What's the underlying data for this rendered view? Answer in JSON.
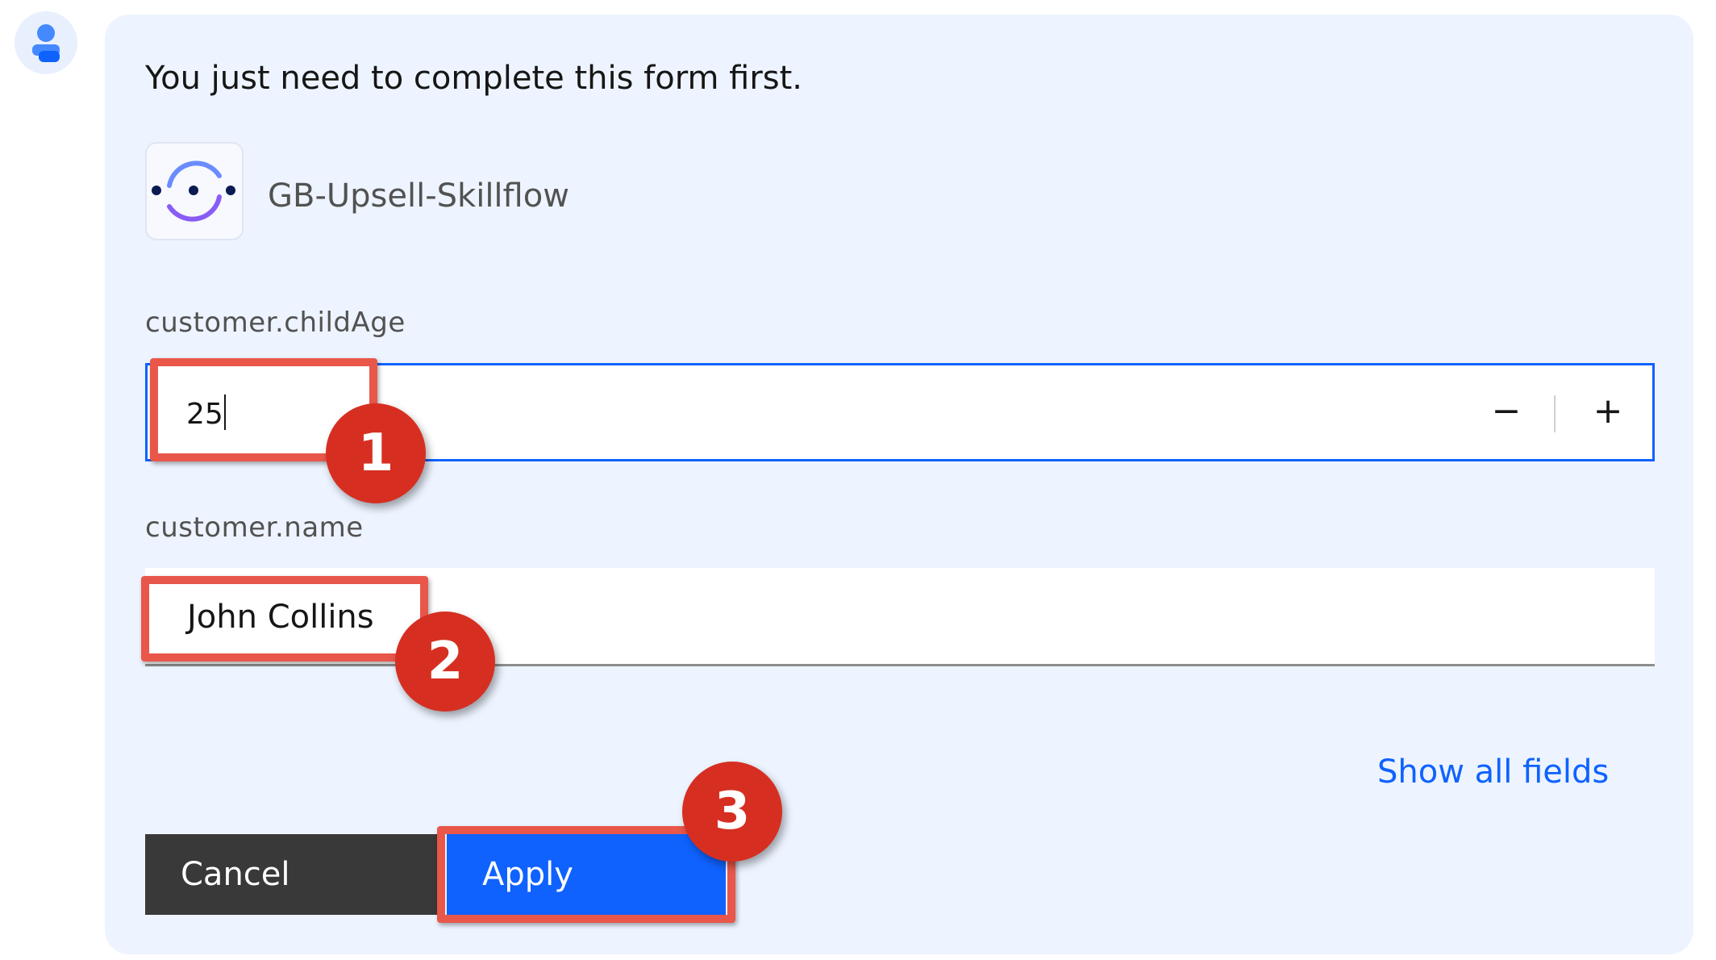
{
  "chat": {
    "prompt": "You just need to complete this form first."
  },
  "skill": {
    "name": "GB-Upsell-Skillflow",
    "logo_icon": "skillflow-logo-icon"
  },
  "form": {
    "fields": [
      {
        "label": "customer.childAge",
        "value": "25",
        "type": "number",
        "decrement_symbol": "−",
        "increment_symbol": "+"
      },
      {
        "label": "customer.name",
        "value": "John Collins",
        "type": "text"
      }
    ],
    "show_all_label": "Show all fields",
    "cancel_label": "Cancel",
    "apply_label": "Apply"
  },
  "annotations": {
    "steps": [
      "1",
      "2",
      "3"
    ],
    "highlight_color": "#e8574a",
    "badge_color": "#d62f21"
  },
  "colors": {
    "card_background": "#edf4ff",
    "primary": "#0f62fe",
    "secondary_button": "#393939"
  }
}
